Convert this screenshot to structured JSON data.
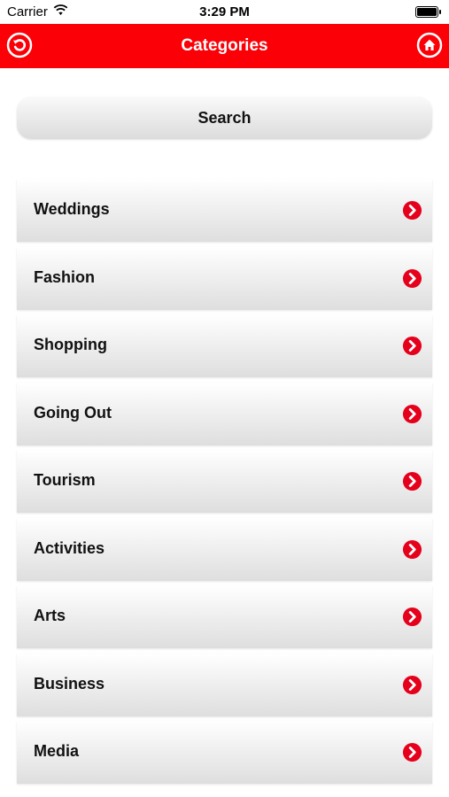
{
  "status_bar": {
    "carrier": "Carrier",
    "time": "3:29 PM"
  },
  "header": {
    "title": "Categories",
    "back_icon": "back-arrow-circle-icon",
    "home_icon": "home-circle-icon",
    "color": "#fb0007"
  },
  "search": {
    "label": "Search"
  },
  "categories": [
    {
      "label": "Weddings"
    },
    {
      "label": "Fashion"
    },
    {
      "label": "Shopping"
    },
    {
      "label": "Going Out"
    },
    {
      "label": "Tourism"
    },
    {
      "label": "Activities"
    },
    {
      "label": "Arts"
    },
    {
      "label": "Business"
    },
    {
      "label": "Media"
    }
  ],
  "colors": {
    "accent": "#fb0007",
    "chevron": "#e5001c"
  }
}
